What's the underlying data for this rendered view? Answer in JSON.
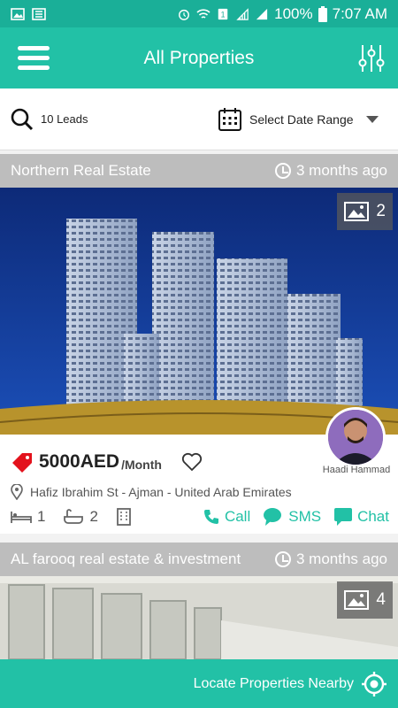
{
  "status_bar": {
    "battery": "100%",
    "time": "7:07 AM"
  },
  "app_bar": {
    "title": "All Properties"
  },
  "search": {
    "leads": "10 Leads",
    "date_range": "Select Date Range"
  },
  "listings": [
    {
      "agency": "Northern Real Estate",
      "posted": "3 months ago",
      "image_count": "2",
      "price": "5000AED",
      "period": "/Month",
      "address": "Hafiz Ibrahim St - Ajman - United Arab Emirates",
      "beds": "1",
      "baths": "2",
      "agent_name": "Haadi Hammad",
      "actions": {
        "call": "Call",
        "sms": "SMS",
        "chat": "Chat"
      }
    },
    {
      "agency": "AL farooq real estate & investment",
      "posted": "3 months ago",
      "image_count": "4"
    }
  ],
  "bottom_bar": {
    "label": "Locate Properties Nearby"
  },
  "colors": {
    "primary": "#22c1a6",
    "status": "#1aaf98",
    "header_grey": "#bdbdbd",
    "price_tag": "#e3121c"
  }
}
